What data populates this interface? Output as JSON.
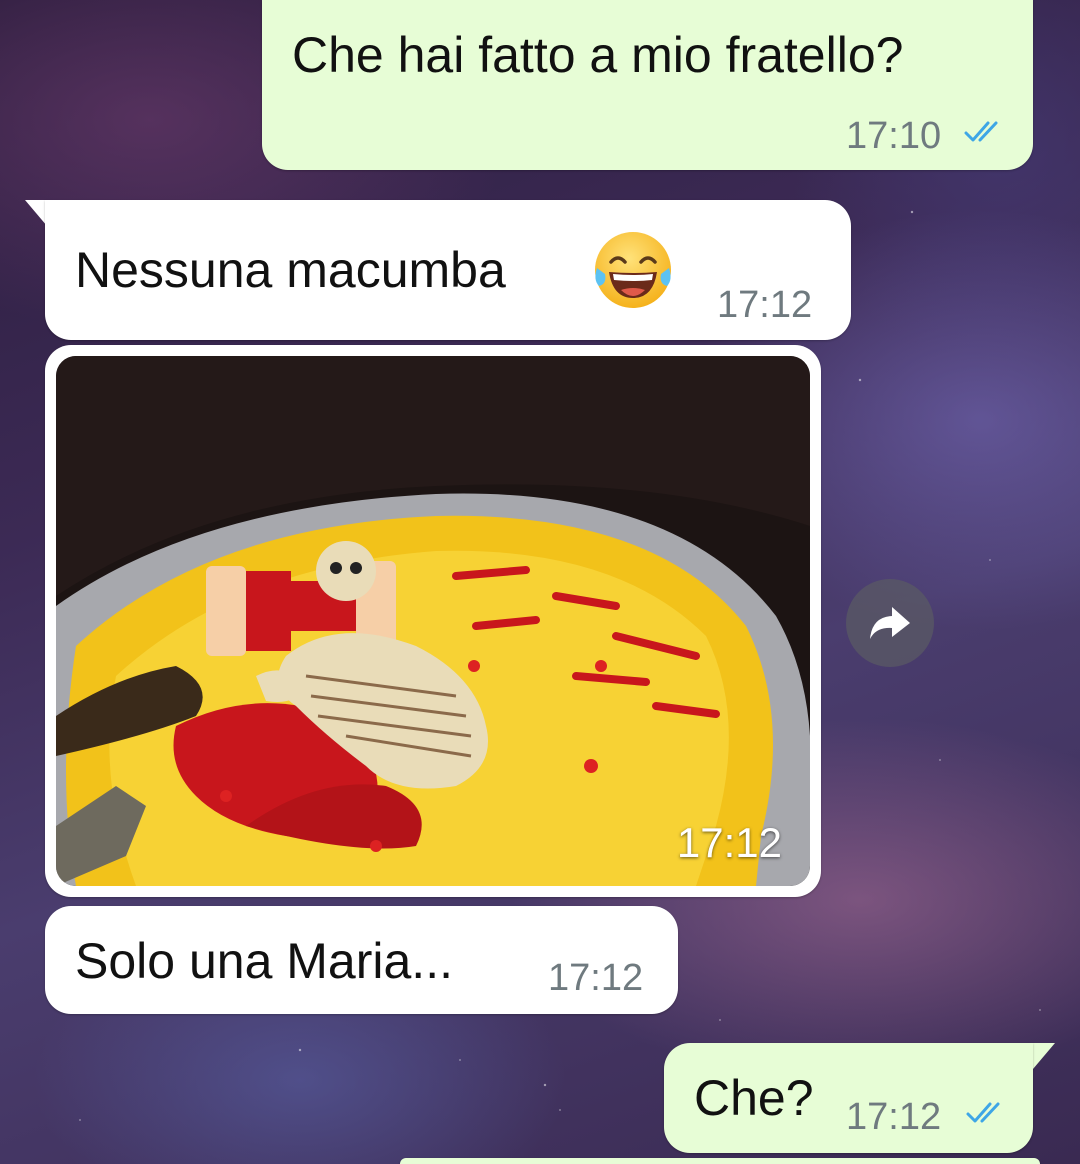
{
  "chat": {
    "messages": [
      {
        "direction": "outgoing",
        "text": "Che hai fatto a mio fratello?",
        "time": "17:10",
        "status": "read"
      },
      {
        "direction": "incoming",
        "text": "Nessuna macumba",
        "emoji": "face-with-tears-of-joy",
        "time": "17:12"
      },
      {
        "direction": "incoming",
        "type": "image",
        "image_desc": "painting",
        "time": "17:12"
      },
      {
        "direction": "incoming",
        "text": "Solo una Maria...",
        "time": "17:12"
      },
      {
        "direction": "outgoing",
        "text": "Che?",
        "time": "17:12",
        "status": "read"
      }
    ]
  },
  "colors": {
    "outgoing_bubble": "#e7fdd6",
    "incoming_bubble": "#ffffff",
    "read_ticks": "#3ea6e6",
    "timestamp": "#6f7a7f"
  }
}
